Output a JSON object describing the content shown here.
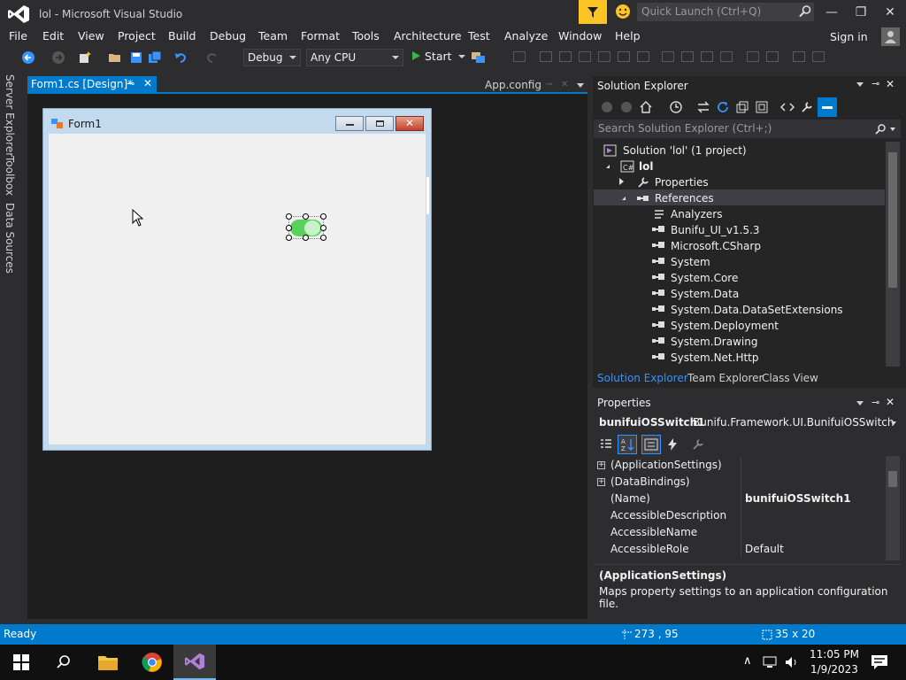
{
  "window": {
    "title": "lol - Microsoft Visual Studio",
    "minimize": "—",
    "restore": "❐",
    "close": "✕"
  },
  "quick_launch": {
    "placeholder": "Quick Launch (Ctrl+Q)"
  },
  "menu": [
    "File",
    "Edit",
    "View",
    "Project",
    "Build",
    "Debug",
    "Team",
    "Format",
    "Tools",
    "Architecture",
    "Test",
    "Analyze",
    "Window",
    "Help"
  ],
  "account": {
    "signin": "Sign in"
  },
  "toolbar": {
    "config": "Debug",
    "platform": "Any CPU",
    "start": "Start"
  },
  "left_rail": [
    "Server Explorer",
    "Toolbox",
    "Data Sources"
  ],
  "doc_tabs": {
    "active": "Form1.cs [Design]*",
    "other": "App.config"
  },
  "designer": {
    "form_title": "Form1"
  },
  "solution_explorer": {
    "title": "Solution Explorer",
    "search_placeholder": "Search Solution Explorer (Ctrl+;)",
    "solution": "Solution 'lol' (1 project)",
    "project": "lol",
    "properties": "Properties",
    "references": "References",
    "refs": [
      "Analyzers",
      "Bunifu_UI_v1.5.3",
      "Microsoft.CSharp",
      "System",
      "System.Core",
      "System.Data",
      "System.Data.DataSetExtensions",
      "System.Deployment",
      "System.Drawing",
      "System.Net.Http"
    ],
    "tabs": [
      "Solution Explorer",
      "Team Explorer",
      "Class View"
    ]
  },
  "properties": {
    "title": "Properties",
    "object_name": "bunifuiOSSwitch1",
    "object_type": "Bunifu.Framework.UI.BunifuiOSSwitch",
    "rows": [
      {
        "name": "(ApplicationSettings)",
        "value": "",
        "expand": "+"
      },
      {
        "name": "(DataBindings)",
        "value": "",
        "expand": "+"
      },
      {
        "name": "(Name)",
        "value": "bunifuiOSSwitch1",
        "expand": ""
      },
      {
        "name": "AccessibleDescription",
        "value": "",
        "expand": ""
      },
      {
        "name": "AccessibleName",
        "value": "",
        "expand": ""
      },
      {
        "name": "AccessibleRole",
        "value": "Default",
        "expand": ""
      }
    ],
    "desc_title": "(ApplicationSettings)",
    "desc_text": "Maps property settings to an application configuration file."
  },
  "status": {
    "text": "Ready",
    "position": "273 , 95",
    "size": "35 x 20"
  },
  "taskbar": {
    "time": "11:05 PM",
    "date": "1/9/2023"
  },
  "colors": {
    "accent": "#007acc",
    "switch_on": "#5ad15a"
  }
}
